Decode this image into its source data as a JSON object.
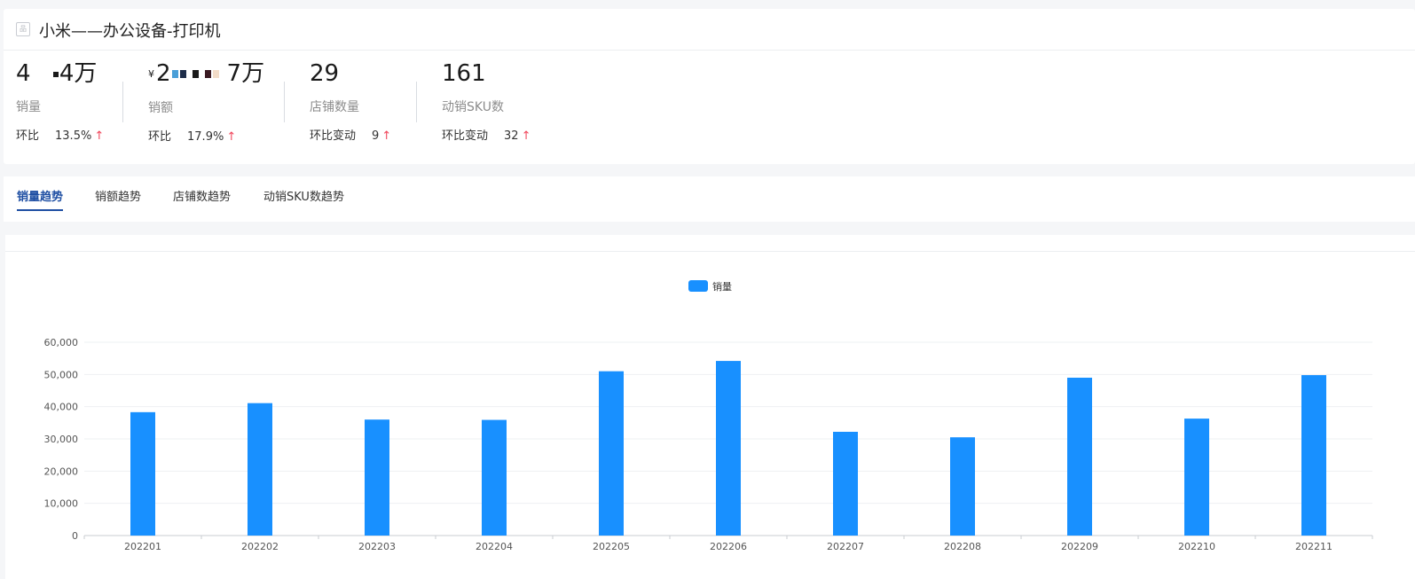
{
  "header": {
    "title": "小米——办公设备-打印机",
    "icon": "product-icon"
  },
  "metrics": [
    {
      "value_prefix": "4",
      "value_suffix": "4万",
      "label": "销量",
      "compare_label": "环比",
      "compare_value": "13.5%",
      "trend": "↑"
    },
    {
      "currency": "¥",
      "value_prefix": "2",
      "value_suffix": "7万",
      "label": "销额",
      "compare_label": "环比",
      "compare_value": "17.9%",
      "trend": "↑"
    },
    {
      "value": "29",
      "label": "店铺数量",
      "compare_label": "环比变动",
      "compare_value": "9",
      "trend": "↑"
    },
    {
      "value": "161",
      "label": "动销SKU数",
      "compare_label": "环比变动",
      "compare_value": "32",
      "trend": "↑"
    }
  ],
  "tabs": [
    {
      "label": "销量趋势",
      "active": true
    },
    {
      "label": "销额趋势",
      "active": false
    },
    {
      "label": "店铺数趋势",
      "active": false
    },
    {
      "label": "动销SKU数趋势",
      "active": false
    }
  ],
  "colors": {
    "bar": "#1890ff",
    "up": "#f0455a",
    "active_tab": "#1f4fa3"
  },
  "chart_data": {
    "type": "bar",
    "legend": [
      "销量"
    ],
    "legend_position": "top-center",
    "categories": [
      "202201",
      "202202",
      "202203",
      "202204",
      "202205",
      "202206",
      "202207",
      "202208",
      "202209",
      "202210",
      "202211"
    ],
    "series": [
      {
        "name": "销量",
        "values": [
          38300,
          41100,
          36000,
          35900,
          51000,
          54200,
          32200,
          30500,
          49000,
          36300,
          49800
        ]
      }
    ],
    "yticks": [
      "0",
      "10,000",
      "20,000",
      "30,000",
      "40,000",
      "50,000",
      "60,000"
    ],
    "ylim": [
      0,
      60000
    ],
    "grid": true
  }
}
